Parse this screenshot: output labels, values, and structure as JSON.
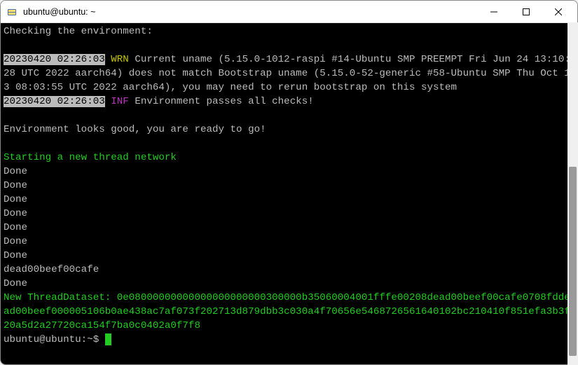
{
  "window": {
    "title": "ubuntu@ubuntu: ~"
  },
  "lines": {
    "checking": "Checking the environment:",
    "blank": " ",
    "ts1": "20230420 02:26:03",
    "wrn": "WRN",
    "wrn_msg": "Current uname (5.15.0-1012-raspi #14-Ubuntu SMP PREEMPT Fri Jun 24 13:10:28 UTC 2022 aarch64) does not match Bootstrap uname (5.15.0-52-generic #58-Ubuntu SMP Thu Oct 13 08:03:55 UTC 2022 aarch64), you may need to rerun bootstrap on this system",
    "ts2": "20230420 02:26:03",
    "inf": "INF",
    "inf_msg": "Environment passes all checks!",
    "env_good": "Environment looks good, you are ready to go!",
    "starting": "Starting a new thread network",
    "done": "Done",
    "deadbeef": "dead00beef00cafe",
    "dataset": "New ThreadDataset: 0e08000000000000000000000300000b35060004001fffe00208dead00beef00cafe0708fddead00beef000005106b0ae438ac7af073f202713d879dbb3c030a4f70656e5468726561640102bc210410f851efa3b3f20a5d2a27720ca154f7ba0c0402a0f7f8",
    "prompt": "ubuntu@ubuntu:~$ "
  }
}
